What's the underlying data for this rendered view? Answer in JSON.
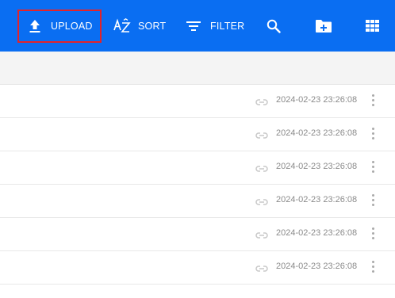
{
  "toolbar": {
    "upload_label": "UPLOAD",
    "sort_label": "SORT",
    "filter_label": "FILTER",
    "color": "#0a6ef2",
    "highlight_color": "#e3232a"
  },
  "rows": [
    {
      "date": "2024-02-23 23:26:08"
    },
    {
      "date": "2024-02-23 23:26:08"
    },
    {
      "date": "2024-02-23 23:26:08"
    },
    {
      "date": "2024-02-23 23:26:08"
    },
    {
      "date": "2024-02-23 23:26:08"
    },
    {
      "date": "2024-02-23 23:26:08"
    }
  ]
}
